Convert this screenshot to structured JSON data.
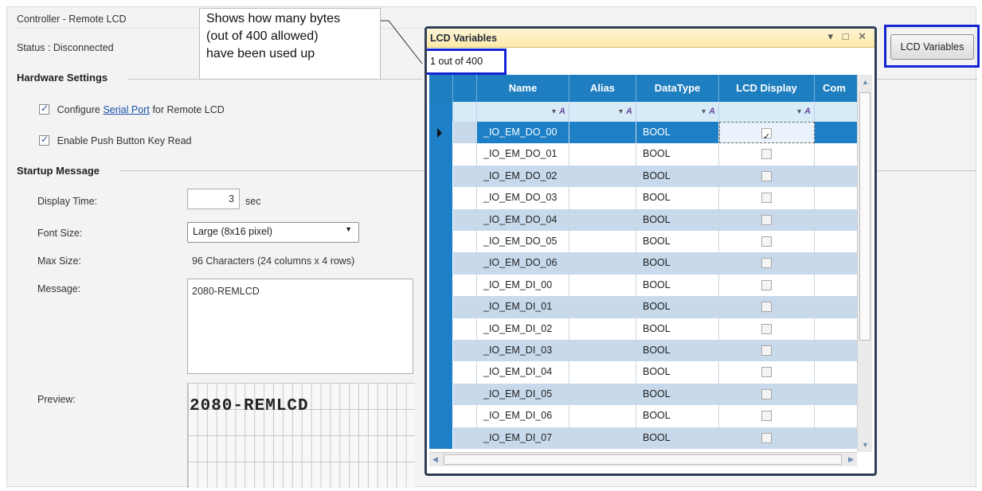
{
  "panel": {
    "title": "Controller - Remote LCD",
    "status": "Status : Disconnected",
    "hardware_settings": "Hardware Settings",
    "configure_prefix": "Configure",
    "configure_link": "Serial Port",
    "configure_suffix": "for Remote LCD",
    "configure_checked": true,
    "push_button": "Enable Push Button Key Read",
    "push_button_checked": true,
    "startup_message": "Startup Message",
    "display_time_label": "Display Time:",
    "display_time_value": "3",
    "display_time_unit": "sec",
    "font_size_label": "Font Size:",
    "font_size_value": "Large (8x16 pixel)",
    "max_size_label": "Max Size:",
    "max_size_value": "96 Characters (24 columns x 4 rows)",
    "message_label": "Message:",
    "message_value": "2080-REMLCD",
    "preview_label": "Preview:",
    "preview_text": "2080-REMLCD"
  },
  "callout": {
    "line1": "Shows how many bytes",
    "line2": "(out of 400 allowed)",
    "line3": "have been used up"
  },
  "lcd_button": {
    "label": "LCD Variables"
  },
  "window": {
    "title": "LCD Variables",
    "controls": "▾ □ ✕",
    "counter": "1 out of 400",
    "columns": [
      "Name",
      "Alias",
      "DataType",
      "LCD Display",
      "Com"
    ],
    "rows": [
      {
        "name": "_IO_EM_DO_00",
        "alias": "",
        "type": "BOOL",
        "lcd": true
      },
      {
        "name": "_IO_EM_DO_01",
        "alias": "",
        "type": "BOOL",
        "lcd": false
      },
      {
        "name": "_IO_EM_DO_02",
        "alias": "",
        "type": "BOOL",
        "lcd": false
      },
      {
        "name": "_IO_EM_DO_03",
        "alias": "",
        "type": "BOOL",
        "lcd": false
      },
      {
        "name": "_IO_EM_DO_04",
        "alias": "",
        "type": "BOOL",
        "lcd": false
      },
      {
        "name": "_IO_EM_DO_05",
        "alias": "",
        "type": "BOOL",
        "lcd": false
      },
      {
        "name": "_IO_EM_DO_06",
        "alias": "",
        "type": "BOOL",
        "lcd": false
      },
      {
        "name": "_IO_EM_DI_00",
        "alias": "",
        "type": "BOOL",
        "lcd": false
      },
      {
        "name": "_IO_EM_DI_01",
        "alias": "",
        "type": "BOOL",
        "lcd": false
      },
      {
        "name": "_IO_EM_DI_02",
        "alias": "",
        "type": "BOOL",
        "lcd": false
      },
      {
        "name": "_IO_EM_DI_03",
        "alias": "",
        "type": "BOOL",
        "lcd": false
      },
      {
        "name": "_IO_EM_DI_04",
        "alias": "",
        "type": "BOOL",
        "lcd": false
      },
      {
        "name": "_IO_EM_DI_05",
        "alias": "",
        "type": "BOOL",
        "lcd": false
      },
      {
        "name": "_IO_EM_DI_06",
        "alias": "",
        "type": "BOOL",
        "lcd": false
      },
      {
        "name": "_IO_EM_DI_07",
        "alias": "",
        "type": "BOOL",
        "lcd": false
      }
    ],
    "selected_row": 0
  },
  "colors": {
    "header_blue": "#1e7ec0",
    "row_alt": "#c8d9ec",
    "highlight_box": "#1325d3",
    "title_bar": "#fde9a8"
  }
}
